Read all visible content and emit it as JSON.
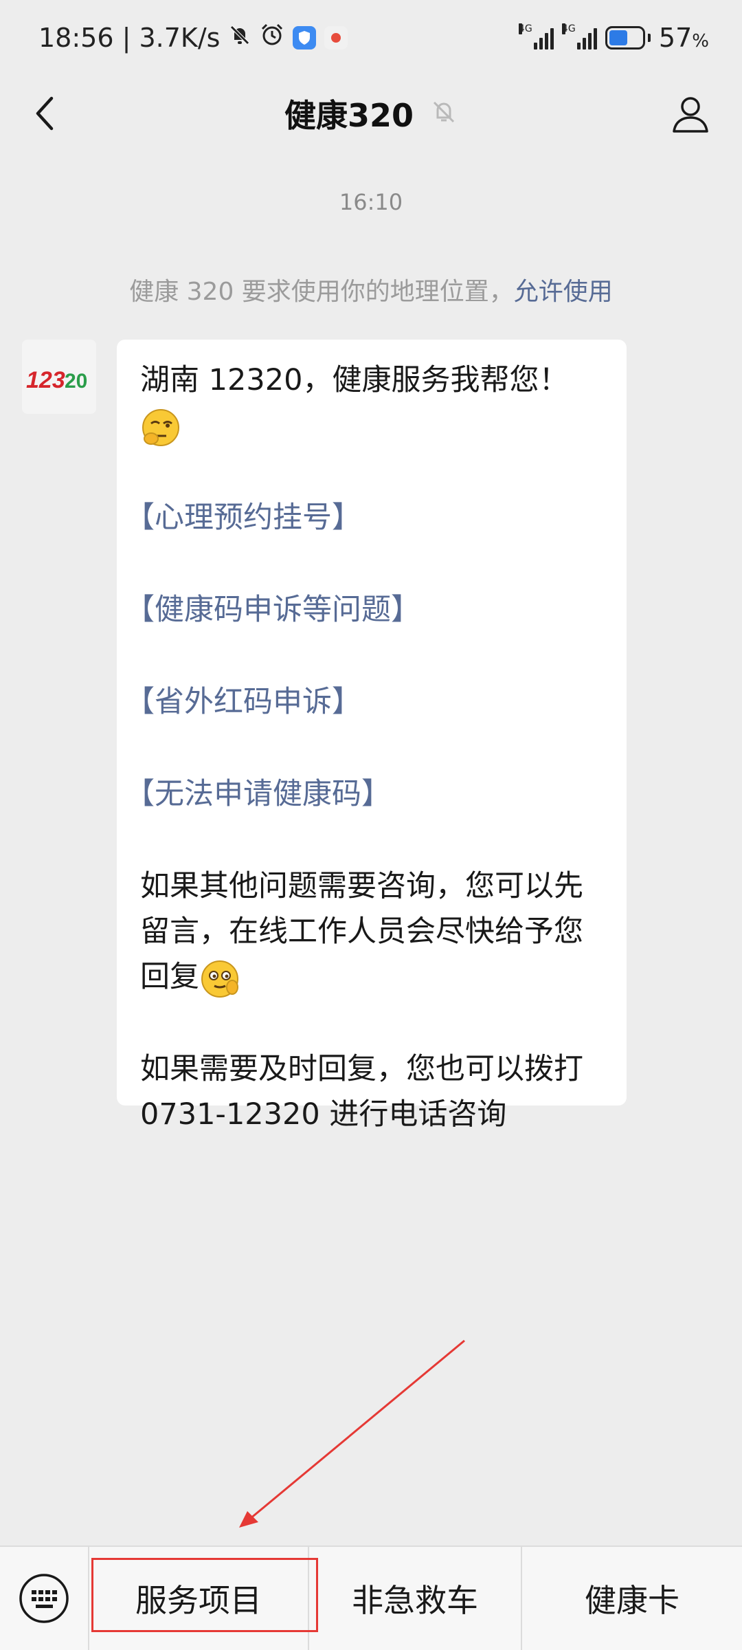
{
  "status_bar": {
    "time_speed": "18:56 | 3.7K/s",
    "network_1": "4G",
    "network_2": "4G",
    "battery_pct": "57",
    "battery_unit": "%"
  },
  "header": {
    "title": "健康320"
  },
  "chat": {
    "timestamp": "16:10",
    "system_prefix": "健康 320 要求使用你的地理位置，",
    "system_link": "允许使用",
    "messages": {
      "greeting": "湖南 12320，健康服务我帮您！",
      "links": [
        "【心理预约挂号】",
        "【健康码申诉等问题】",
        "【省外红码申诉】",
        "【无法申请健康码】"
      ],
      "para1": "如果其他问题需要咨询，您可以先留言，在线工作人员会尽快给予您回复",
      "para2": "如果需要及时回复，您也可以拨打0731-12320 进行电话咨询"
    }
  },
  "avatar": {
    "text_a": "123",
    "text_b": "20"
  },
  "bottom_menu": {
    "items": [
      "服务项目",
      "非急救车",
      "健康卡"
    ]
  },
  "colors": {
    "link": "#576b95",
    "annotation": "#e53935",
    "background": "#ededed"
  },
  "icons": [
    "back-icon",
    "mute-bell-icon",
    "profile-icon",
    "keyboard-icon",
    "thinking-emoji-icon",
    "grinning-emoji-icon",
    "annotation-arrow-icon"
  ]
}
